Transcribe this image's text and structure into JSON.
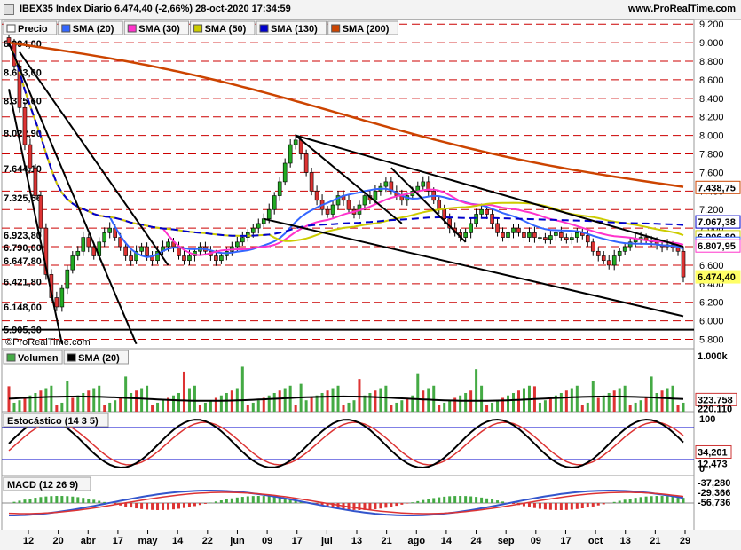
{
  "window": {
    "title": "IBEX35 Index Diario 6.474,40 (-2,66%) 28-oct-2020 17:34:59",
    "site": "www.ProRealTime.com",
    "watermark": "©ProRealTime.com"
  },
  "legend_main": [
    {
      "label": "Precio",
      "color": "#ffffff"
    },
    {
      "label": "SMA (20)",
      "color": "#3366ff"
    },
    {
      "label": "SMA (30)",
      "color": "#ff33cc"
    },
    {
      "label": "SMA (50)",
      "color": "#cccc00"
    },
    {
      "label": "SMA (130)",
      "color": "#0000cc"
    },
    {
      "label": "SMA (200)",
      "color": "#cc4400"
    }
  ],
  "legend_volume": [
    {
      "label": "Volumen",
      "color": "#44aa44"
    },
    {
      "label": "SMA (20)",
      "color": "#000000"
    }
  ],
  "legend_stoch": {
    "label": "Estocástico (14 3 5)"
  },
  "legend_macd": {
    "label": "MACD (12 26 9)"
  },
  "chart_data": {
    "type": "candlestick",
    "title": "IBEX35 Index Diario",
    "y_axis_ticks": [
      "9.200",
      "9.000",
      "8.800",
      "8.600",
      "8.400",
      "8.200",
      "8.000",
      "7.800",
      "7.600",
      "7.400",
      "7.200",
      "7.000",
      "6.800",
      "6.600",
      "6.400",
      "6.200",
      "6.000",
      "5.800"
    ],
    "ylim": [
      5700,
      9250
    ],
    "left_price_labels": [
      "8.994,00",
      "8.683,00",
      "8.375,60",
      "8.022,90",
      "7.644,10",
      "7.325,56",
      "6.923,80",
      "6.790,00",
      "6.647,80",
      "6.421,80",
      "6.148,00",
      "5.905,30"
    ],
    "right_value_badges": [
      {
        "label": "7.438,75",
        "value": 7438.75,
        "color": "#cc4400"
      },
      {
        "label": "7.067,38",
        "value": 7067.38,
        "color": "#0000cc"
      },
      {
        "label": "6.906,80",
        "value": 6906.8,
        "color": "#cccc00"
      },
      {
        "label": "6.836,70",
        "value": 6836.7,
        "color": "#3366ff"
      },
      {
        "label": "6.807,95",
        "value": 6807.95,
        "color": "#ff33cc"
      },
      {
        "label": "6.474,40",
        "value": 6474.4,
        "color": "#ffff66"
      }
    ],
    "x_tick_labels": [
      "12",
      "20",
      "abr",
      "17",
      "may",
      "14",
      "22",
      "jun",
      "09",
      "17",
      "jul",
      "13",
      "21",
      "ago",
      "14",
      "24",
      "sep",
      "09",
      "17",
      "oct",
      "13",
      "21",
      "29"
    ],
    "close_series": [
      8994,
      8750,
      8300,
      7900,
      7650,
      7350,
      7000,
      6500,
      6250,
      6150,
      6350,
      6550,
      6700,
      6750,
      6900,
      6800,
      6700,
      6850,
      6950,
      7000,
      6900,
      6800,
      6700,
      6650,
      6750,
      6800,
      6700,
      6650,
      6750,
      6800,
      6850,
      6800,
      6700,
      6650,
      6700,
      6750,
      6800,
      6750,
      6700,
      6650,
      6700,
      6750,
      6800,
      6850,
      6900,
      6950,
      7000,
      7050,
      7100,
      7200,
      7350,
      7500,
      7700,
      7900,
      7950,
      7800,
      7600,
      7400,
      7300,
      7200,
      7150,
      7250,
      7350,
      7300,
      7200,
      7150,
      7250,
      7350,
      7300,
      7400,
      7450,
      7500,
      7400,
      7350,
      7300,
      7350,
      7400,
      7450,
      7500,
      7400,
      7300,
      7200,
      7100,
      7000,
      6950,
      6900,
      6950,
      7050,
      7150,
      7200,
      7150,
      7050,
      6950,
      6900,
      6950,
      7000,
      6950,
      6900,
      6950,
      6900,
      6900,
      6880,
      6920,
      6950,
      6900,
      6880,
      6900,
      6950,
      6920,
      6850,
      6750,
      6700,
      6650,
      6600,
      6700,
      6750,
      6800,
      6850,
      6880,
      6900,
      6870,
      6850,
      6820,
      6800,
      6820,
      6790,
      6750,
      6474
    ],
    "volume": {
      "y_axis_ticks": [
        "1.000k"
      ],
      "sma20_label": "323.758",
      "value_label": "220.110",
      "sma20": 223758,
      "value": 220110
    },
    "stochastic": {
      "y_axis_ticks": [
        "100",
        "0"
      ],
      "k_label": "34,201",
      "d_label": "12,473",
      "k": 34.201,
      "d": 12.473
    },
    "macd": {
      "labels": [
        "-37,280",
        "-29,366",
        "-56,736"
      ],
      "values": [
        -37.28,
        -29.366,
        -56.736
      ]
    }
  }
}
